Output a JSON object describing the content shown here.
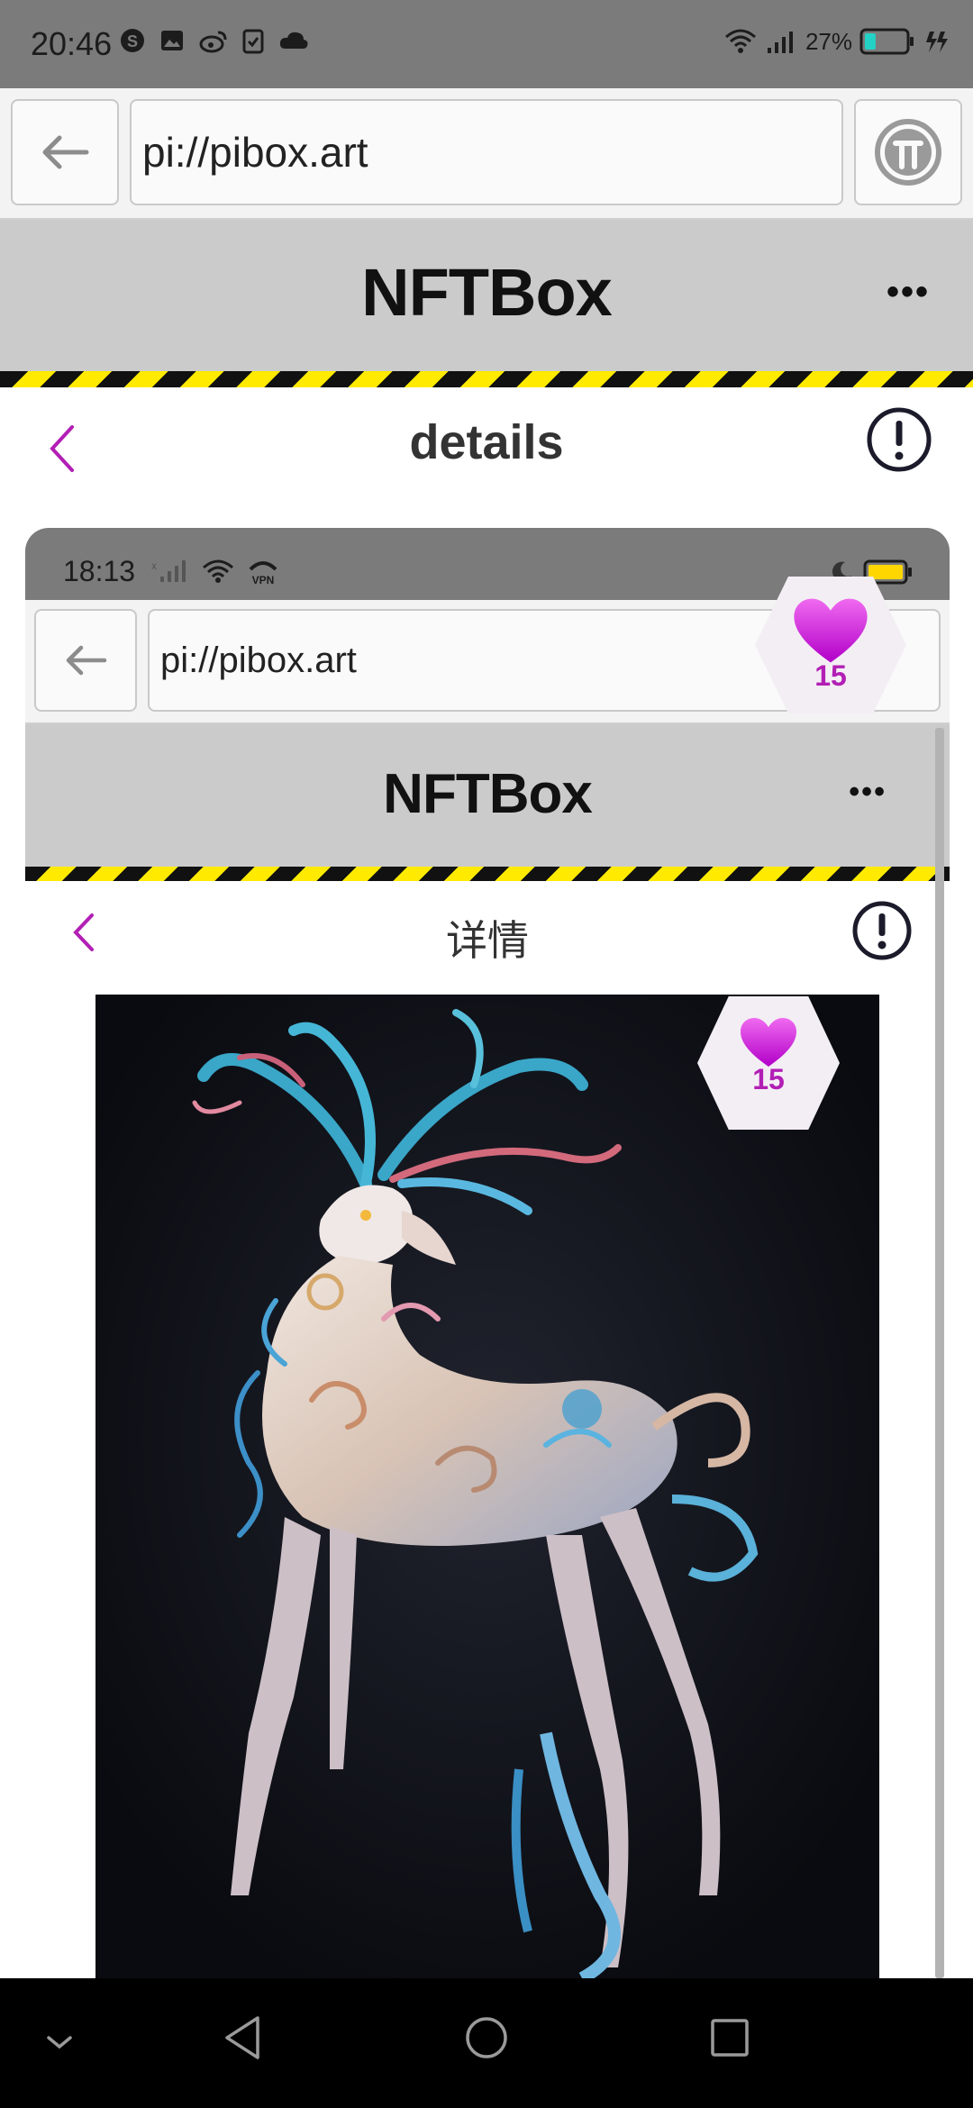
{
  "status_bar": {
    "time": "20:46",
    "battery_percent": "27%",
    "battery_level": 0.27,
    "icons_left": [
      "s-circle-icon",
      "image-icon",
      "weibo-icon",
      "clipboard-icon",
      "cloud-icon"
    ],
    "icons_right": [
      "wifi-icon",
      "signal-icon",
      "battery-icon",
      "charging-icon"
    ]
  },
  "browser": {
    "url": "pi://pibox.art",
    "back_icon": "arrow-left-icon",
    "pi_icon": "pi-logo-icon"
  },
  "app_header": {
    "title": "NFTBox",
    "more": "•••"
  },
  "details": {
    "title": "details",
    "back_icon": "chevron-left-icon",
    "info_icon": "info-icon"
  },
  "embedded_screenshot": {
    "status_bar": {
      "time": "18:13",
      "vpn_label": "VPN"
    },
    "browser": {
      "url": "pi://pibox.art"
    },
    "app_header": {
      "title": "NFTBox",
      "more": "•••"
    },
    "details": {
      "title": "详情"
    },
    "like_badge": {
      "count": "15"
    }
  },
  "like_badge": {
    "count": "15"
  },
  "colors": {
    "accent_magenta": "#b21fb5",
    "heart_gradient_top": "#f06af0",
    "heart_gradient_bottom": "#b100c8",
    "header_gray": "#cbcbcb",
    "hazard_yellow": "#ffea00"
  },
  "nav_bar": {
    "items": [
      "chevron-down-icon",
      "back-triangle-icon",
      "home-circle-icon",
      "recents-square-icon"
    ]
  }
}
